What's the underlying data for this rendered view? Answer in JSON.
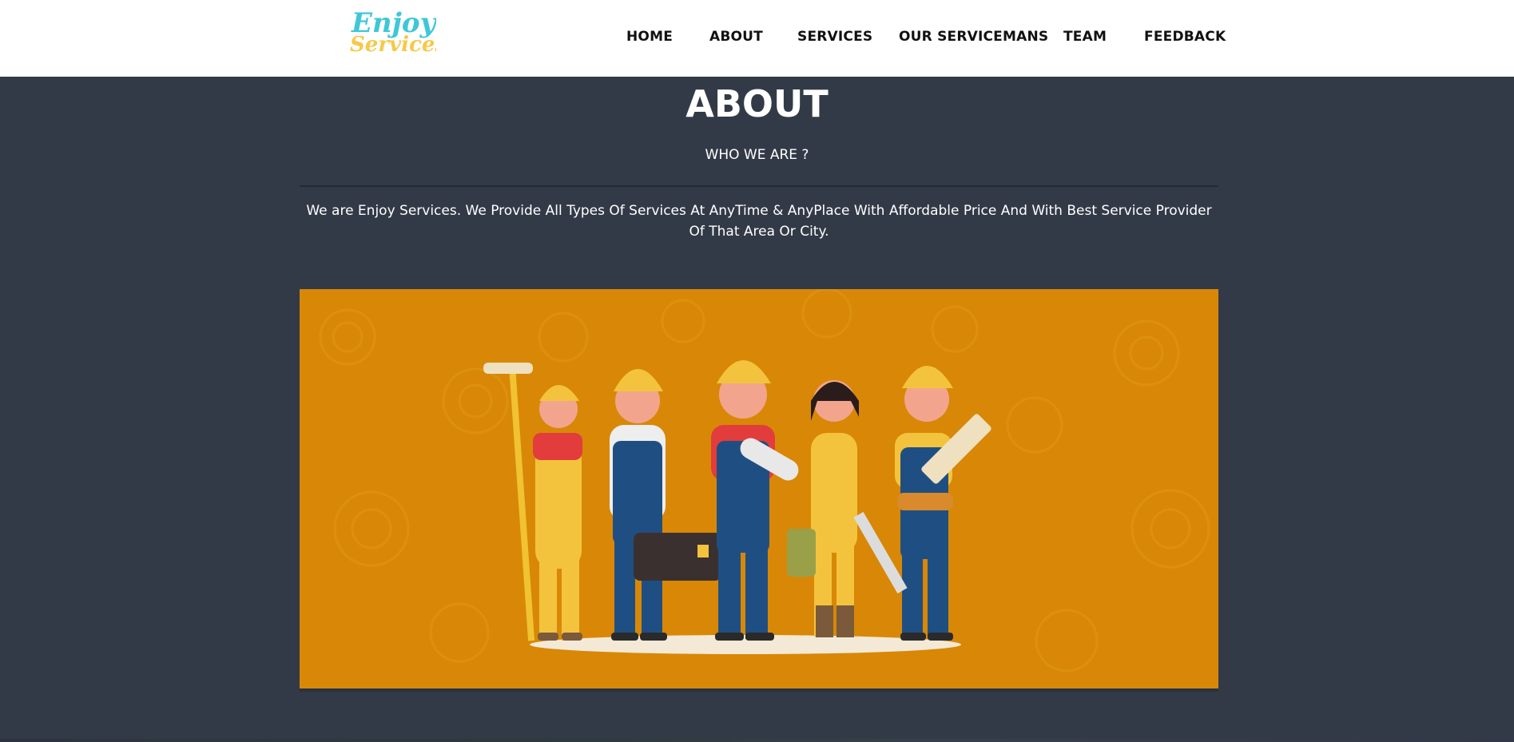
{
  "header": {
    "logo_text_line1": "Enjoy",
    "logo_text_line2": "Services",
    "nav": [
      {
        "label": "HOME"
      },
      {
        "label": "ABOUT"
      },
      {
        "label": "SERVICES"
      },
      {
        "label": "OUR SERVICEMANS"
      },
      {
        "label": "TEAM"
      },
      {
        "label": "FEEDBACK"
      }
    ]
  },
  "about": {
    "title": "ABOUT",
    "subtitle": "WHO WE ARE ?",
    "description": "We are Enjoy Services. We Provide All Types Of Services At AnyTime & AnyPlace With Affordable Price And With Best Service Provider Of That Area Or City."
  },
  "colors": {
    "background": "#333a47",
    "header_bg": "#ffffff",
    "banner_bg": "#d88806",
    "logo_cyan": "#3fc7d9",
    "logo_yellow": "#f6c94a"
  }
}
